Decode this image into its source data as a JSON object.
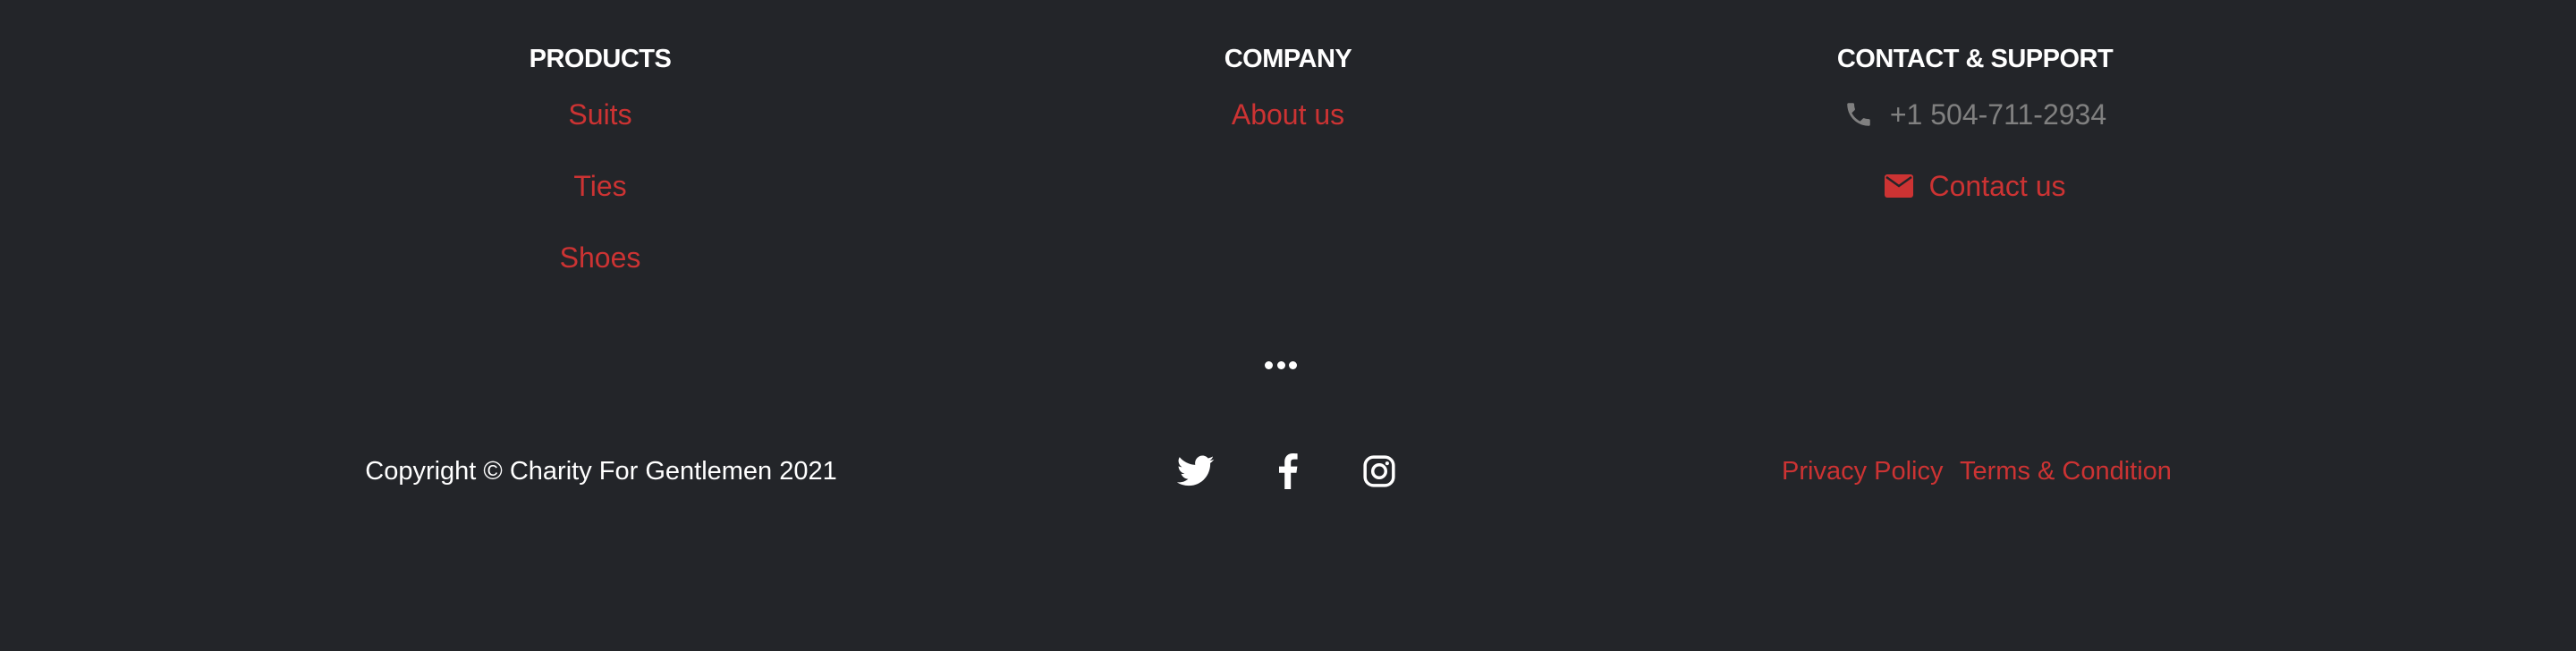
{
  "colors": {
    "background": "#232529",
    "heading": "#ffffff",
    "link": "#cc3333",
    "muted": "#808080"
  },
  "products": {
    "title": "PRODUCTS",
    "items": [
      {
        "label": "Suits"
      },
      {
        "label": "Ties"
      },
      {
        "label": "Shoes"
      }
    ]
  },
  "company": {
    "title": "COMPANY",
    "items": [
      {
        "label": "About us"
      }
    ]
  },
  "contact": {
    "title": "CONTACT & SUPPORT",
    "phone": {
      "icon": "phone-icon",
      "text": "+1 504-711-2934"
    },
    "email": {
      "icon": "envelope-icon",
      "text": "Contact us"
    }
  },
  "divider": {
    "icon": "ellipsis-icon"
  },
  "bottom": {
    "copyright": "Copyright © Charity For Gentlemen 2021",
    "social": [
      {
        "icon": "twitter-icon"
      },
      {
        "icon": "facebook-icon"
      },
      {
        "icon": "instagram-icon"
      }
    ],
    "legal": {
      "privacy": "Privacy Policy",
      "terms": "Terms & Condition"
    }
  }
}
